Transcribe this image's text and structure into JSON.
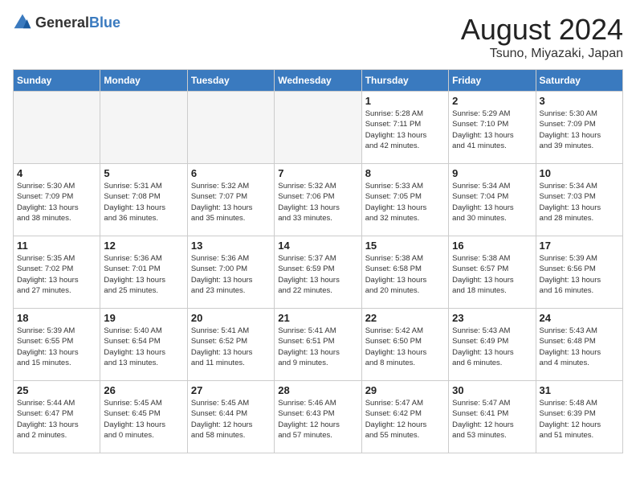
{
  "header": {
    "logo_general": "General",
    "logo_blue": "Blue",
    "month": "August 2024",
    "location": "Tsuno, Miyazaki, Japan"
  },
  "weekdays": [
    "Sunday",
    "Monday",
    "Tuesday",
    "Wednesday",
    "Thursday",
    "Friday",
    "Saturday"
  ],
  "weeks": [
    [
      {
        "day": "",
        "info": ""
      },
      {
        "day": "",
        "info": ""
      },
      {
        "day": "",
        "info": ""
      },
      {
        "day": "",
        "info": ""
      },
      {
        "day": "1",
        "info": "Sunrise: 5:28 AM\nSunset: 7:11 PM\nDaylight: 13 hours\nand 42 minutes."
      },
      {
        "day": "2",
        "info": "Sunrise: 5:29 AM\nSunset: 7:10 PM\nDaylight: 13 hours\nand 41 minutes."
      },
      {
        "day": "3",
        "info": "Sunrise: 5:30 AM\nSunset: 7:09 PM\nDaylight: 13 hours\nand 39 minutes."
      }
    ],
    [
      {
        "day": "4",
        "info": "Sunrise: 5:30 AM\nSunset: 7:09 PM\nDaylight: 13 hours\nand 38 minutes."
      },
      {
        "day": "5",
        "info": "Sunrise: 5:31 AM\nSunset: 7:08 PM\nDaylight: 13 hours\nand 36 minutes."
      },
      {
        "day": "6",
        "info": "Sunrise: 5:32 AM\nSunset: 7:07 PM\nDaylight: 13 hours\nand 35 minutes."
      },
      {
        "day": "7",
        "info": "Sunrise: 5:32 AM\nSunset: 7:06 PM\nDaylight: 13 hours\nand 33 minutes."
      },
      {
        "day": "8",
        "info": "Sunrise: 5:33 AM\nSunset: 7:05 PM\nDaylight: 13 hours\nand 32 minutes."
      },
      {
        "day": "9",
        "info": "Sunrise: 5:34 AM\nSunset: 7:04 PM\nDaylight: 13 hours\nand 30 minutes."
      },
      {
        "day": "10",
        "info": "Sunrise: 5:34 AM\nSunset: 7:03 PM\nDaylight: 13 hours\nand 28 minutes."
      }
    ],
    [
      {
        "day": "11",
        "info": "Sunrise: 5:35 AM\nSunset: 7:02 PM\nDaylight: 13 hours\nand 27 minutes."
      },
      {
        "day": "12",
        "info": "Sunrise: 5:36 AM\nSunset: 7:01 PM\nDaylight: 13 hours\nand 25 minutes."
      },
      {
        "day": "13",
        "info": "Sunrise: 5:36 AM\nSunset: 7:00 PM\nDaylight: 13 hours\nand 23 minutes."
      },
      {
        "day": "14",
        "info": "Sunrise: 5:37 AM\nSunset: 6:59 PM\nDaylight: 13 hours\nand 22 minutes."
      },
      {
        "day": "15",
        "info": "Sunrise: 5:38 AM\nSunset: 6:58 PM\nDaylight: 13 hours\nand 20 minutes."
      },
      {
        "day": "16",
        "info": "Sunrise: 5:38 AM\nSunset: 6:57 PM\nDaylight: 13 hours\nand 18 minutes."
      },
      {
        "day": "17",
        "info": "Sunrise: 5:39 AM\nSunset: 6:56 PM\nDaylight: 13 hours\nand 16 minutes."
      }
    ],
    [
      {
        "day": "18",
        "info": "Sunrise: 5:39 AM\nSunset: 6:55 PM\nDaylight: 13 hours\nand 15 minutes."
      },
      {
        "day": "19",
        "info": "Sunrise: 5:40 AM\nSunset: 6:54 PM\nDaylight: 13 hours\nand 13 minutes."
      },
      {
        "day": "20",
        "info": "Sunrise: 5:41 AM\nSunset: 6:52 PM\nDaylight: 13 hours\nand 11 minutes."
      },
      {
        "day": "21",
        "info": "Sunrise: 5:41 AM\nSunset: 6:51 PM\nDaylight: 13 hours\nand 9 minutes."
      },
      {
        "day": "22",
        "info": "Sunrise: 5:42 AM\nSunset: 6:50 PM\nDaylight: 13 hours\nand 8 minutes."
      },
      {
        "day": "23",
        "info": "Sunrise: 5:43 AM\nSunset: 6:49 PM\nDaylight: 13 hours\nand 6 minutes."
      },
      {
        "day": "24",
        "info": "Sunrise: 5:43 AM\nSunset: 6:48 PM\nDaylight: 13 hours\nand 4 minutes."
      }
    ],
    [
      {
        "day": "25",
        "info": "Sunrise: 5:44 AM\nSunset: 6:47 PM\nDaylight: 13 hours\nand 2 minutes."
      },
      {
        "day": "26",
        "info": "Sunrise: 5:45 AM\nSunset: 6:45 PM\nDaylight: 13 hours\nand 0 minutes."
      },
      {
        "day": "27",
        "info": "Sunrise: 5:45 AM\nSunset: 6:44 PM\nDaylight: 12 hours\nand 58 minutes."
      },
      {
        "day": "28",
        "info": "Sunrise: 5:46 AM\nSunset: 6:43 PM\nDaylight: 12 hours\nand 57 minutes."
      },
      {
        "day": "29",
        "info": "Sunrise: 5:47 AM\nSunset: 6:42 PM\nDaylight: 12 hours\nand 55 minutes."
      },
      {
        "day": "30",
        "info": "Sunrise: 5:47 AM\nSunset: 6:41 PM\nDaylight: 12 hours\nand 53 minutes."
      },
      {
        "day": "31",
        "info": "Sunrise: 5:48 AM\nSunset: 6:39 PM\nDaylight: 12 hours\nand 51 minutes."
      }
    ]
  ]
}
